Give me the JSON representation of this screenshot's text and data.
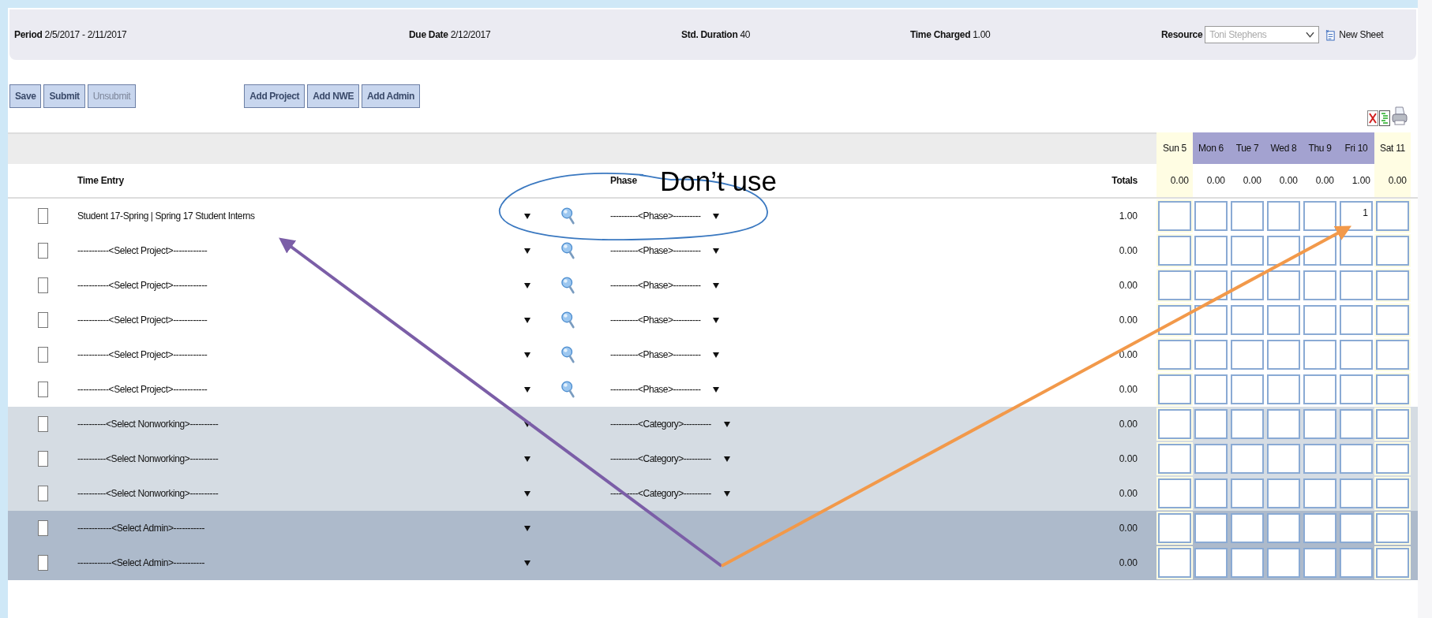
{
  "summary": {
    "period_label": "Period",
    "period": "2/5/2017 - 2/11/2017",
    "due_label": "Due Date",
    "due": "2/12/2017",
    "duration_label": "Std. Duration",
    "duration": "40",
    "charged_label": "Time Charged",
    "charged": "1.00",
    "resource_label": "Resource",
    "resource": "Toni Stephens",
    "new_sheet": "New Sheet"
  },
  "buttons": [
    {
      "label": "Save",
      "disabled": false
    },
    {
      "label": "Submit",
      "disabled": false
    },
    {
      "label": "Unsubmit",
      "disabled": true
    }
  ],
  "add_buttons": [
    {
      "label": "Add Project",
      "disabled": false
    },
    {
      "label": "Add NWE",
      "disabled": false
    },
    {
      "label": "Add Admin",
      "disabled": false
    }
  ],
  "table": {
    "time_entry_header": "Time Entry",
    "phase_header": "Phase",
    "totals_header": "Totals",
    "days": [
      {
        "label": "Sun 5",
        "weekend": true,
        "total": "0.00"
      },
      {
        "label": "Mon 6",
        "weekend": false,
        "total": "0.00"
      },
      {
        "label": "Tue 7",
        "weekend": false,
        "total": "0.00"
      },
      {
        "label": "Wed 8",
        "weekend": false,
        "total": "0.00"
      },
      {
        "label": "Thu 9",
        "weekend": false,
        "total": "0.00"
      },
      {
        "label": "Fri 10",
        "weekend": false,
        "total": "1.00"
      },
      {
        "label": "Sat 11",
        "weekend": true,
        "total": "0.00"
      }
    ],
    "rows": [
      {
        "kind": "project",
        "checked": false,
        "entry": "Student 17-Spring | Spring 17 Student Interns",
        "phase": "----------<Phase>----------",
        "total": "1.00",
        "cells": [
          {
            "empty": true
          },
          {
            "empty": true
          },
          {
            "empty": true
          },
          {
            "empty": true
          },
          {
            "empty": true
          },
          {
            "empty": false,
            "value": "1"
          },
          {
            "empty": true
          }
        ]
      },
      {
        "kind": "project",
        "checked": false,
        "entry": "-----------<Select Project>------------",
        "phase": "----------<Phase>----------",
        "total": "0.00"
      },
      {
        "kind": "project",
        "checked": false,
        "entry": "-----------<Select Project>------------",
        "phase": "----------<Phase>----------",
        "total": "0.00"
      },
      {
        "kind": "project",
        "checked": false,
        "entry": "-----------<Select Project>------------",
        "phase": "----------<Phase>----------",
        "total": "0.00"
      },
      {
        "kind": "project",
        "checked": false,
        "entry": "-----------<Select Project>------------",
        "phase": "----------<Phase>----------",
        "total": "0.00"
      },
      {
        "kind": "project",
        "checked": false,
        "entry": "-----------<Select Project>------------",
        "phase": "----------<Phase>----------",
        "total": "0.00"
      },
      {
        "kind": "nonworking",
        "checked": false,
        "entry": "----------<Select Nonworking>----------",
        "phase": "----------<Category>----------",
        "total": "0.00"
      },
      {
        "kind": "nonworking",
        "checked": false,
        "entry": "----------<Select Nonworking>----------",
        "phase": "----------<Category>----------",
        "total": "0.00"
      },
      {
        "kind": "nonworking",
        "checked": false,
        "entry": "----------<Select Nonworking>----------",
        "phase": "----------<Category>----------",
        "total": "0.00"
      },
      {
        "kind": "admin",
        "checked": false,
        "entry": "------------<Select Admin>-----------",
        "total": "0.00"
      },
      {
        "kind": "admin",
        "checked": false,
        "entry": "------------<Select Admin>-----------",
        "total": "0.00"
      }
    ]
  },
  "annotation": {
    "note": "Don’t use"
  }
}
